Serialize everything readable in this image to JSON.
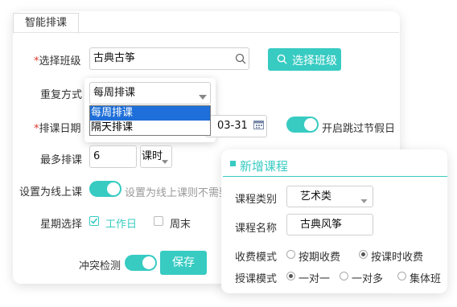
{
  "tab": {
    "label": "智能排课"
  },
  "form": {
    "class_select": {
      "required_mark": "*",
      "label": "选择班级",
      "value": "古典古筝",
      "button_label": "选择班级"
    },
    "repeat": {
      "label": "重复方式",
      "value": "每周排课",
      "options": [
        "每周排课",
        "隔天排课"
      ],
      "selected_index": 0
    },
    "date": {
      "required_mark": "*",
      "label": "排课日期",
      "end_value": "03-31"
    },
    "skip_holiday": {
      "label": "开启跳过节假日",
      "on": true
    },
    "max": {
      "label": "最多排课",
      "value": "6",
      "unit": "课时"
    },
    "online": {
      "label": "设置为线上课",
      "on": true,
      "hint": "设置为线上课则不需要"
    },
    "weekday": {
      "label": "星期选择",
      "workday_label": "工作日",
      "workday_checked": true,
      "weekend_label": "周末",
      "weekend_checked": false
    },
    "conflict": {
      "label": "冲突检测",
      "on": true
    },
    "save_label": "保存"
  },
  "popup": {
    "title": "新增课程",
    "category": {
      "label": "课程类别",
      "value": "艺术类"
    },
    "name": {
      "label": "课程名称",
      "value": "古典风筝"
    },
    "fee_mode": {
      "label": "收费模式",
      "options": [
        "按期收费",
        "按课时收费"
      ],
      "selected_index": 1
    },
    "teach_mode": {
      "label": "授课模式",
      "options": [
        "一对一",
        "一对多",
        "集体班"
      ],
      "selected_index": 0
    }
  },
  "colors": {
    "accent": "#37cbc2",
    "required": "#e0392c",
    "dropdown_highlight": "#1e6fd9"
  }
}
